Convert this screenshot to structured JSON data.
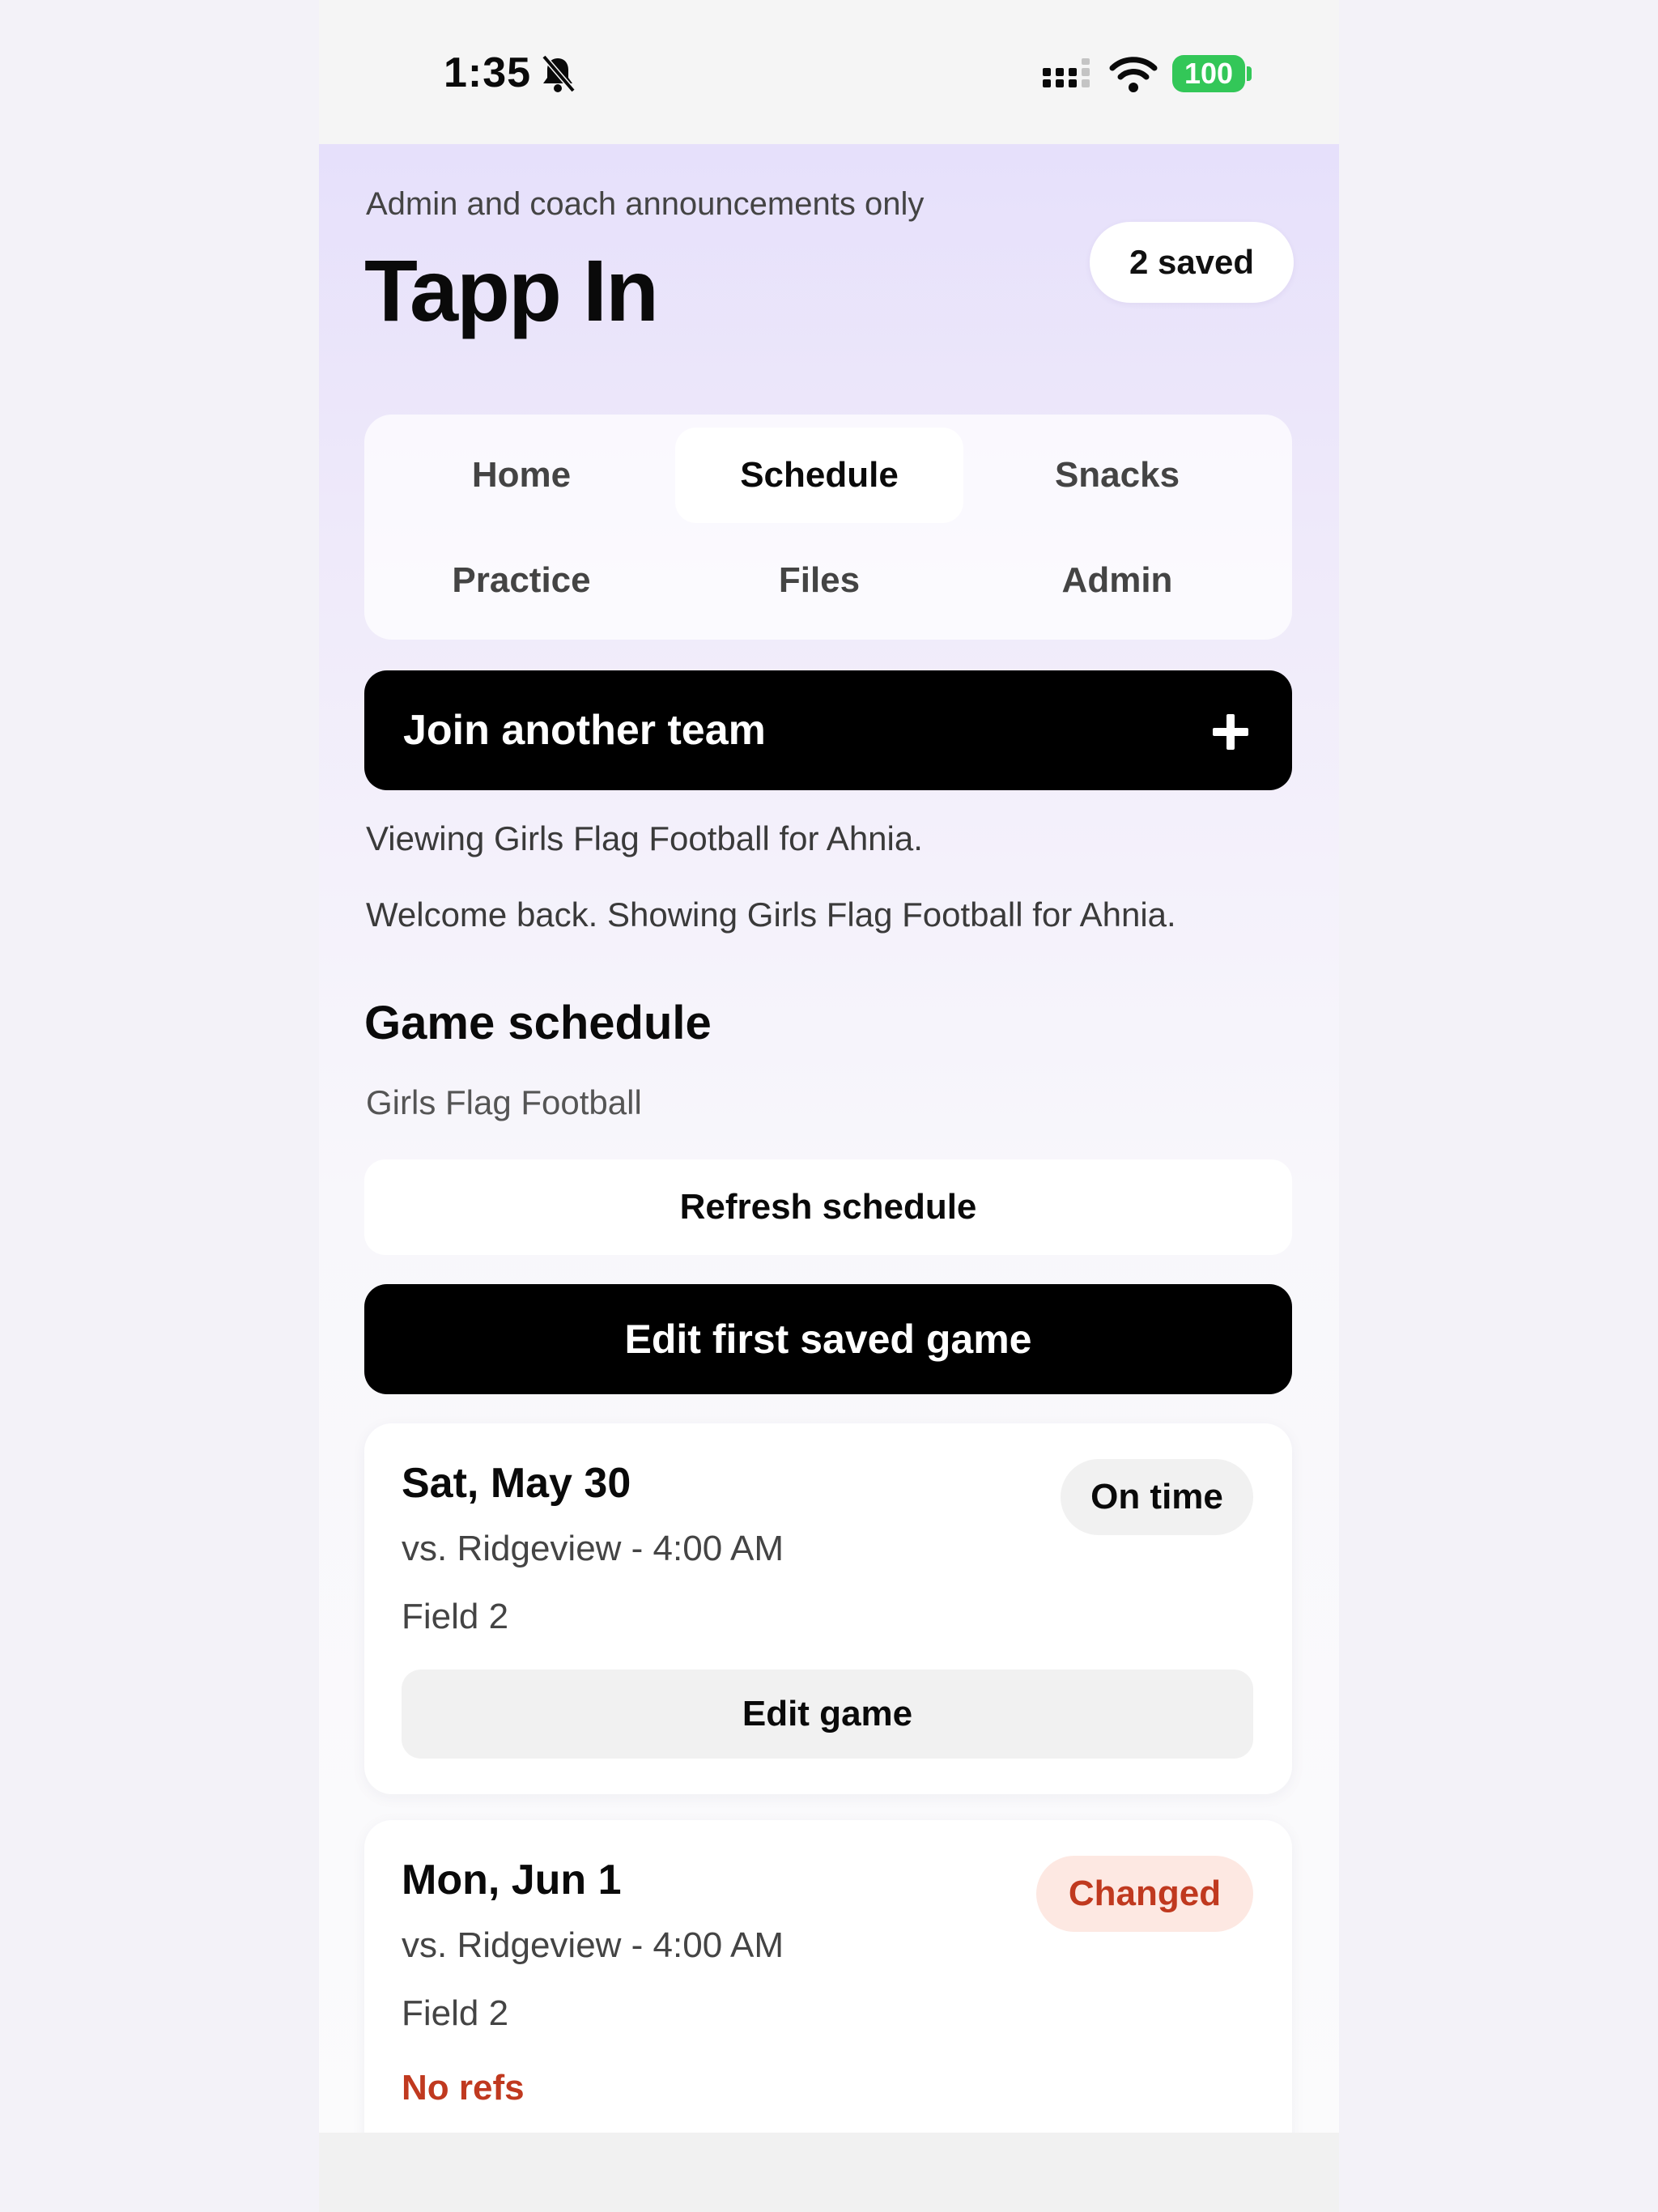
{
  "status_bar": {
    "time": "1:35",
    "battery": "100"
  },
  "header": {
    "subtitle": "Admin and coach announcements only",
    "title": "Tapp In",
    "saved_count": "2 saved"
  },
  "tabs": [
    {
      "label": "Home",
      "active": false
    },
    {
      "label": "Schedule",
      "active": true
    },
    {
      "label": "Snacks",
      "active": false
    },
    {
      "label": "Practice",
      "active": false
    },
    {
      "label": "Files",
      "active": false
    },
    {
      "label": "Admin",
      "active": false
    }
  ],
  "join_button": {
    "label": "Join another team",
    "icon": "plus-icon"
  },
  "info": {
    "viewing": "Viewing Girls Flag Football for Ahnia.",
    "welcome": "Welcome back. Showing Girls Flag Football for Ahnia."
  },
  "schedule": {
    "title": "Game schedule",
    "team": "Girls Flag Football",
    "refresh_label": "Refresh schedule",
    "edit_first_label": "Edit first saved game"
  },
  "games": [
    {
      "date": "Sat, May 30",
      "opponent": "vs. Ridgeview - 4:00 AM",
      "field": "Field 2",
      "status": "On time",
      "edit_label": "Edit game"
    },
    {
      "date": "Mon, Jun 1",
      "opponent": "vs. Ridgeview - 4:00 AM",
      "field": "Field 2",
      "status": "Changed",
      "note": "No refs"
    }
  ],
  "colors": {
    "accent_dark": "#000000",
    "status_changed": "#c0391f",
    "status_changed_bg": "#fde8e2",
    "battery_green": "#33c758"
  }
}
